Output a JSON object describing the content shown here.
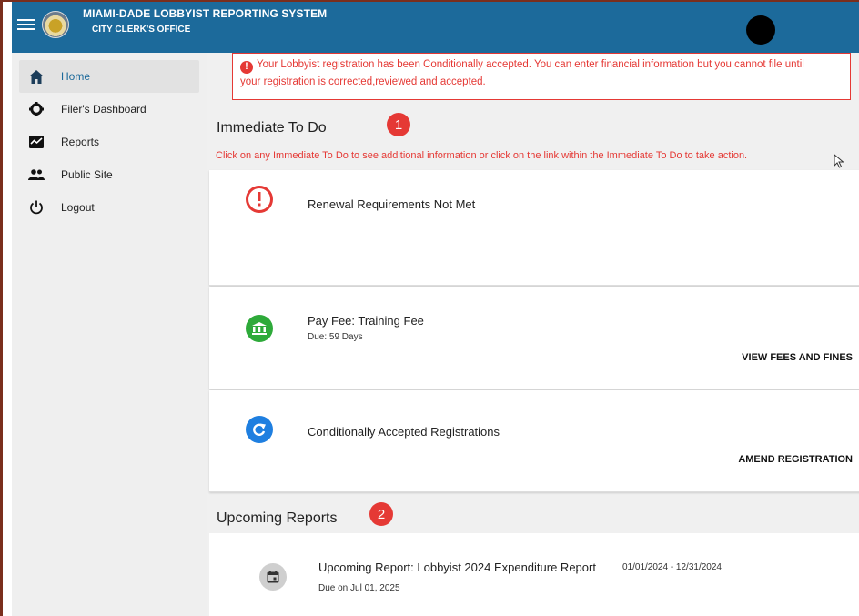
{
  "header": {
    "title": "MIAMI-DADE LOBBYIST REPORTING SYSTEM",
    "subtitle": "CITY CLERK'S OFFICE"
  },
  "sidebar": {
    "items": [
      {
        "label": "Home",
        "icon": "home-icon"
      },
      {
        "label": "Filer's Dashboard",
        "icon": "gear-icon"
      },
      {
        "label": "Reports",
        "icon": "chart-icon"
      },
      {
        "label": "Public Site",
        "icon": "people-icon"
      },
      {
        "label": "Logout",
        "icon": "power-icon"
      }
    ]
  },
  "alert": {
    "line1": "Your Lobbyist registration has been Conditionally accepted. You can enter financial information but you cannot file until",
    "line2": "your registration is corrected,reviewed and accepted.",
    "icon": "!"
  },
  "todo": {
    "title": "Immediate To Do",
    "badge": "1",
    "instructions": "Click on any Immediate To Do to see additional information or click on the link within the Immediate To Do to take action.",
    "items": [
      {
        "title": "Renewal Requirements Not Met",
        "sub": "",
        "action": "",
        "icon": "exclamation-icon"
      },
      {
        "title": "Pay Fee: Training Fee",
        "sub": "Due: 59 Days",
        "action": "VIEW FEES AND FINES",
        "icon": "bank-icon"
      },
      {
        "title": "Conditionally Accepted Registrations",
        "sub": "",
        "action": "AMEND REGISTRATION",
        "icon": "redo-icon"
      }
    ]
  },
  "upcoming": {
    "title": "Upcoming Reports",
    "badge": "2",
    "report": {
      "title": "Upcoming Report: Lobbyist 2024 Expenditure Report",
      "range": "01/01/2024 - 12/31/2024",
      "due": "Due on Jul 01, 2025"
    }
  },
  "colors": {
    "header": "#1c6a9b",
    "alert": "#e53935",
    "fee_icon": "#2eaa3a",
    "redo_icon": "#1f7fe0"
  }
}
